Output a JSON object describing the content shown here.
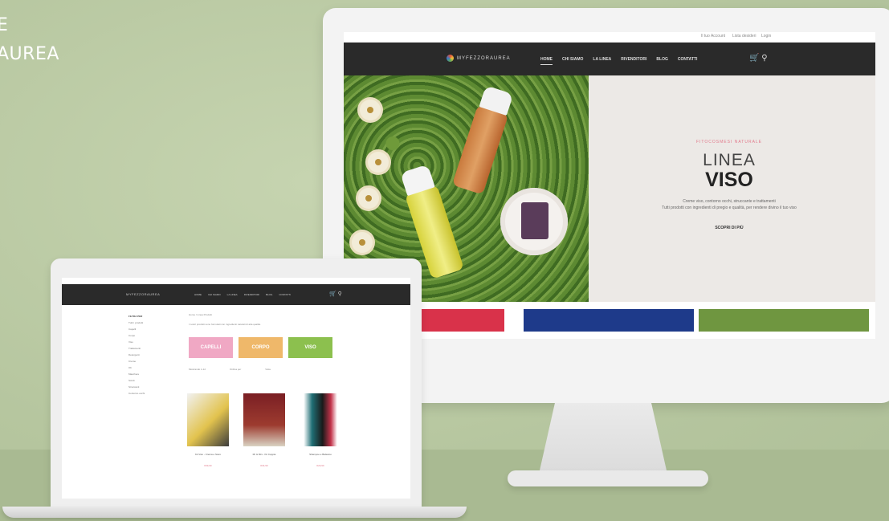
{
  "caption": {
    "line1": "E",
    "line2": "AUREA"
  },
  "desktop": {
    "topbar": {
      "link1": "Il tuo Account",
      "link2": "Lista desideri",
      "link3": "Login"
    },
    "brand": "MYFEZZORAUREA",
    "menu": [
      "HOME",
      "CHI SIAMO",
      "LA LINEA",
      "RIVENDITORI",
      "BLOG",
      "CONTATTI"
    ],
    "hero": {
      "eyebrow": "FITOCOSMESI NATURALE",
      "title_light": "LINEA",
      "title_bold": "VISO",
      "desc_line1": "Creme viso, contorno occhi, struccante e trattamenti",
      "desc_line2": "Tutti prodotti con ingredienti di pregio e qualità, per rendere divino il tuo viso",
      "cta": "SCOPRI DI PIÙ"
    },
    "strip_colors": [
      "#d9324a",
      "#1e3a8a",
      "#6f9640"
    ]
  },
  "laptop": {
    "brand": "MYFEZZORAUREA",
    "menu": [
      "HOME",
      "CHI SIAMO",
      "LA LINEA",
      "RIVENDITORI",
      "BLOG",
      "CONTATTI"
    ],
    "sidebar": {
      "heading": "FILTRA PER",
      "items": [
        "Tutti i prodotti",
        "Capelli",
        "Corpo",
        "Viso",
        "Trattamenti",
        "Detergenti",
        "Creme",
        "Oli",
        "Maschere",
        "Scrub",
        "Struccanti",
        "Contorno occhi"
      ]
    },
    "breadcrumb": "Home / Linea Prodotti",
    "intro": "I nostri prodotti sono formulati con ingredienti naturali di alta qualità.",
    "categories": [
      {
        "label": "CAPELLI",
        "color": "#f0a8c4"
      },
      {
        "label": "CORPO",
        "color": "#efb86a"
      },
      {
        "label": "VISO",
        "color": "#8cc04e"
      }
    ],
    "toolbar": {
      "count": "Mostrando 1-12",
      "sort": "Ordina per",
      "view": "Vista"
    },
    "products": [
      {
        "name": "Kit Viso - Crema e Siero",
        "price": "€39,90"
      },
      {
        "name": "Mr & Mrs - Kit Coppia",
        "price": "€34,90"
      },
      {
        "name": "Shampoo e Balsamo",
        "price": "€29,90"
      }
    ]
  }
}
